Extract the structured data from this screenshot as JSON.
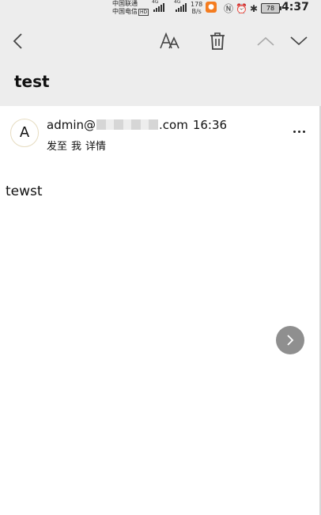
{
  "status_bar": {
    "carrier_1": "中国联通",
    "carrier_2": "中国电信",
    "carrier_2_badge": "HD",
    "network_1": "4G",
    "network_2": "4G",
    "speed_value": "178",
    "speed_unit": "B/s",
    "icons": [
      "nfc-icon",
      "alarm-icon",
      "bluetooth-icon"
    ],
    "battery": "78",
    "time": "4:37"
  },
  "toolbar": {
    "icons": [
      "back-icon",
      "font-size-icon",
      "trash-icon",
      "chevron-up-icon",
      "chevron-down-icon"
    ]
  },
  "email": {
    "subject": "test",
    "avatar_letter": "A",
    "sender_prefix": "admin@",
    "sender_suffix": ".com",
    "sent_time": "16:36",
    "recipient_label": "发至",
    "recipient": "我",
    "details_link": "详情",
    "body": "tewst"
  },
  "colors": {
    "header_bg": "#ededed",
    "background": "#ffffff",
    "fab_bg": "#8f8f8f"
  }
}
